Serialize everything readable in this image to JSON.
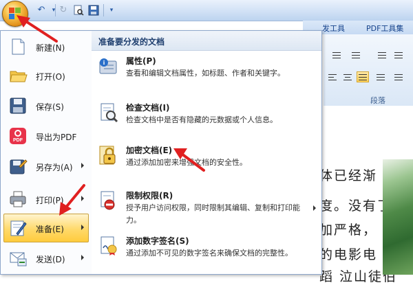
{
  "ribbon": {
    "tabs": [
      "发工具",
      "PDF工具集"
    ],
    "group_label": "段落"
  },
  "document": {
    "lines": [
      "体已经渐",
      "度。没有了",
      "加严格，",
      "的电影电",
      "蹈 泣山徒伯"
    ]
  },
  "menu": {
    "items": [
      {
        "label": "新建(N)",
        "icon": "new-document-icon",
        "submenu": false
      },
      {
        "label": "打开(O)",
        "icon": "open-folder-icon",
        "submenu": false
      },
      {
        "label": "保存(S)",
        "icon": "save-disk-icon",
        "submenu": false
      },
      {
        "label": "导出为PDF",
        "icon": "pdf-export-icon",
        "submenu": false
      },
      {
        "label": "另存为(A)",
        "icon": "save-as-icon",
        "submenu": true
      },
      {
        "label": "打印(P)",
        "icon": "printer-icon",
        "submenu": true
      },
      {
        "label": "准备(E)",
        "icon": "prepare-icon",
        "submenu": true,
        "selected": true
      },
      {
        "label": "发送(D)",
        "icon": "send-icon",
        "submenu": true
      }
    ]
  },
  "submenu": {
    "header": "准备要分发的文档",
    "items": [
      {
        "title": "属性(P)",
        "desc": "查看和编辑文档属性，如标题、作者和关键字。",
        "icon": "properties-icon"
      },
      {
        "title": "检查文档(I)",
        "desc": "检查文档中是否有隐藏的元数据或个人信息。",
        "icon": "inspect-document-icon"
      },
      {
        "title": "加密文档(E)",
        "desc": "通过添加加密来增强文档的安全性。",
        "icon": "encrypt-lock-icon"
      },
      {
        "title": "限制权限(R)",
        "desc": "授予用户访问权限，同时限制其编辑、复制和打印能力。",
        "icon": "restrict-permission-icon"
      },
      {
        "title": "添加数字签名(S)",
        "desc": "通过添加不可见的数字签名来确保文档的完整性。",
        "icon": "digital-signature-icon"
      }
    ]
  },
  "colors": {
    "accent": "#ffd96a",
    "annotation": "#e02020",
    "pdf_red": "#e8334a"
  }
}
